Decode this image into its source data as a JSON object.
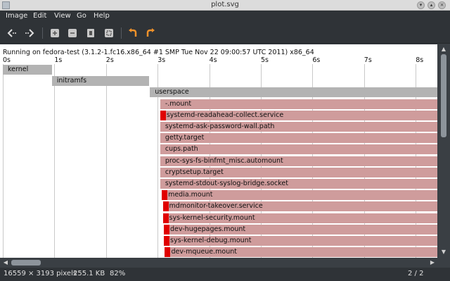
{
  "window": {
    "title": "plot.svg"
  },
  "menu": [
    "Image",
    "Edit",
    "View",
    "Go",
    "Help"
  ],
  "toolbar": {
    "icons": [
      "back-icon",
      "forward-icon",
      "zoom-in-icon",
      "zoom-out-icon",
      "fit-icon",
      "zoom-best-icon",
      "rotate-left-icon",
      "rotate-right-icon"
    ]
  },
  "plot": {
    "header": "Running on fedora-test (3.1.2-1.fc16.x86_64 #1 SMP Tue Nov 22 09:00:57 UTC 2011) x86_64",
    "ticks": [
      "0s",
      "1s",
      "2s",
      "3s",
      "4s",
      "5s",
      "6s",
      "7s",
      "8s"
    ],
    "bars": [
      {
        "label": "kernel",
        "start": 0.0,
        "color": "grey"
      },
      {
        "label": "initramfs",
        "start": 0.95,
        "color": "grey"
      },
      {
        "label": "userspace",
        "start": 2.85,
        "color": "grey"
      },
      {
        "label": "-.mount",
        "start": 3.05,
        "color": "pink"
      },
      {
        "label": "systemd-readahead-collect.service",
        "start": 3.05,
        "color": "pink",
        "red": true
      },
      {
        "label": "systemd-ask-password-wall.path",
        "start": 3.05,
        "color": "pink"
      },
      {
        "label": "getty.target",
        "start": 3.05,
        "color": "pink"
      },
      {
        "label": "cups.path",
        "start": 3.05,
        "color": "pink"
      },
      {
        "label": "proc-sys-fs-binfmt_misc.automount",
        "start": 3.05,
        "color": "pink"
      },
      {
        "label": "cryptsetup.target",
        "start": 3.05,
        "color": "pink"
      },
      {
        "label": "systemd-stdout-syslog-bridge.socket",
        "start": 3.05,
        "color": "pink"
      },
      {
        "label": "media.mount",
        "start": 3.08,
        "color": "pink",
        "red": true
      },
      {
        "label": "mdmonitor-takeover.service",
        "start": 3.1,
        "color": "pink",
        "red": true
      },
      {
        "label": "sys-kernel-security.mount",
        "start": 3.1,
        "color": "pink",
        "red": true
      },
      {
        "label": "dev-hugepages.mount",
        "start": 3.12,
        "color": "pink",
        "red": true
      },
      {
        "label": "sys-kernel-debug.mount",
        "start": 3.12,
        "color": "pink",
        "red": true
      },
      {
        "label": "dev-mqueue.mount",
        "start": 3.14,
        "color": "pink",
        "red": true
      }
    ]
  },
  "status": {
    "dimensions": "16559 × 3193 pixels",
    "size": "255.1 KB",
    "zoom": "82%",
    "page": "2 / 2"
  },
  "colors": {
    "grey_bar": "#b3b3b3",
    "pink_bar": "#cf9c9c",
    "red_mark": "#e00000"
  }
}
